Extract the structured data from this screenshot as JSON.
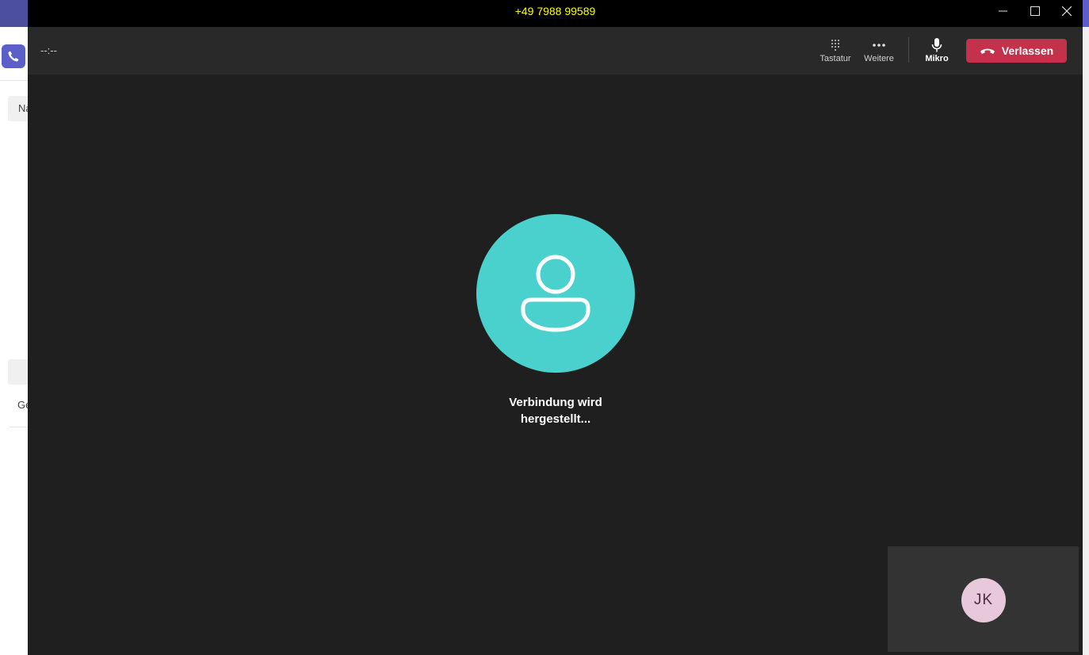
{
  "window": {
    "title": "+49 7988 99589"
  },
  "background_app": {
    "field_label": "Na",
    "list_label": "Ge"
  },
  "toolbar": {
    "timer": "--:--",
    "keypad_label": "Tastatur",
    "more_label": "Weitere",
    "mic_label": "Mikro",
    "leave_label": "Verlassen"
  },
  "call": {
    "status": "Verbindung wird hergestellt..."
  },
  "self_view": {
    "initials": "JK"
  },
  "colors": {
    "leave": "#c4314b",
    "avatar": "#4ad1ce",
    "title": "#ffff00",
    "self_avatar": "#e8c9dc"
  }
}
